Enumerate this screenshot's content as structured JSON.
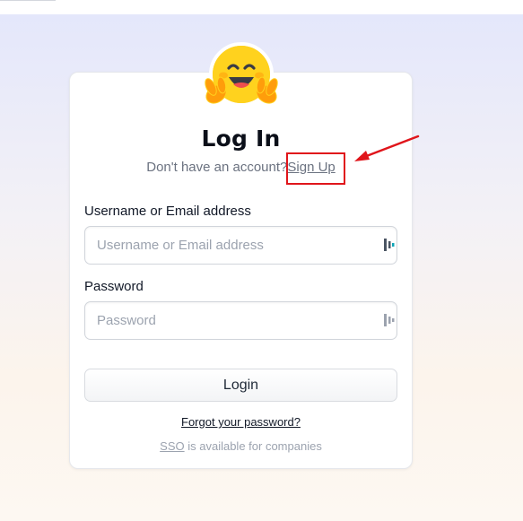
{
  "page": {
    "title": "Log In",
    "no_account_text": "Don't have an account?",
    "signup_link": "Sign Up"
  },
  "form": {
    "username_label": "Username or Email address",
    "username_placeholder": "Username or Email address",
    "username_value": "",
    "password_label": "Password",
    "password_placeholder": "Password",
    "password_value": "",
    "login_button": "Login",
    "forgot_link": "Forgot your password?",
    "sso_link": "SSO",
    "sso_text": " is available for companies"
  },
  "icons": {
    "logo": "hugging-face-logo-icon",
    "annotation_arrow": "red-arrow-icon",
    "password_manager": "password-manager-icon"
  },
  "colors": {
    "annotation_red": "#e0151b",
    "logo_yellow": "#ffd21e",
    "logo_orange": "#ff9d0b",
    "text_dark": "#0b0f19",
    "text_muted": "#6b7280"
  }
}
